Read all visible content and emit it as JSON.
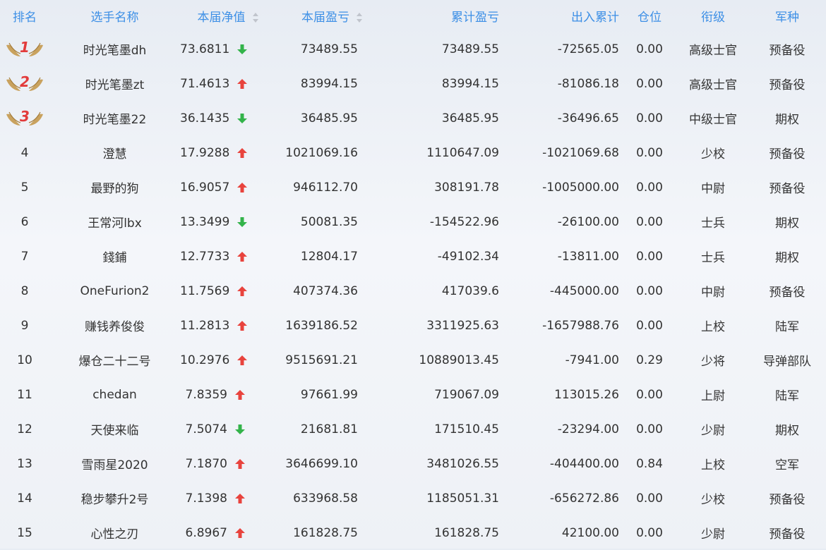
{
  "headers": {
    "rank": "排名",
    "name": "选手名称",
    "nav": "本届净值",
    "profit": "本届盈亏",
    "cum_profit": "累计盈亏",
    "flow": "出入累计",
    "position": "仓位",
    "title": "衔级",
    "branch": "军种"
  },
  "colors": {
    "header": "#3d8fe6",
    "up": "#e8433d",
    "down": "#33b34a",
    "medal_wing": "#c9a25e",
    "medal_num": "#e23b3b"
  },
  "rows": [
    {
      "rank": "1",
      "name": "时光笔墨dh",
      "nav": "73.6811",
      "trend": "down",
      "profit": "73489.55",
      "cum_profit": "73489.55",
      "flow": "-72565.05",
      "position": "0.00",
      "title": "高级士官",
      "branch": "预备役"
    },
    {
      "rank": "2",
      "name": "时光笔墨zt",
      "nav": "71.4613",
      "trend": "up",
      "profit": "83994.15",
      "cum_profit": "83994.15",
      "flow": "-81086.18",
      "position": "0.00",
      "title": "高级士官",
      "branch": "预备役"
    },
    {
      "rank": "3",
      "name": "时光笔墨22",
      "nav": "36.1435",
      "trend": "down",
      "profit": "36485.95",
      "cum_profit": "36485.95",
      "flow": "-36496.65",
      "position": "0.00",
      "title": "中级士官",
      "branch": "期权"
    },
    {
      "rank": "4",
      "name": "澄慧",
      "nav": "17.9288",
      "trend": "up",
      "profit": "1021069.16",
      "cum_profit": "1110647.09",
      "flow": "-1021069.68",
      "position": "0.00",
      "title": "少校",
      "branch": "预备役"
    },
    {
      "rank": "5",
      "name": "最野的狗",
      "nav": "16.9057",
      "trend": "up",
      "profit": "946112.70",
      "cum_profit": "308191.78",
      "flow": "-1005000.00",
      "position": "0.00",
      "title": "中尉",
      "branch": "预备役"
    },
    {
      "rank": "6",
      "name": "王常河lbx",
      "nav": "13.3499",
      "trend": "down",
      "profit": "50081.35",
      "cum_profit": "-154522.96",
      "flow": "-26100.00",
      "position": "0.00",
      "title": "士兵",
      "branch": "期权"
    },
    {
      "rank": "7",
      "name": "錢鋪",
      "nav": "12.7733",
      "trend": "up",
      "profit": "12804.17",
      "cum_profit": "-49102.34",
      "flow": "-13811.00",
      "position": "0.00",
      "title": "士兵",
      "branch": "期权"
    },
    {
      "rank": "8",
      "name": "OneFurion2",
      "nav": "11.7569",
      "trend": "up",
      "profit": "407374.36",
      "cum_profit": "417039.6",
      "flow": "-445000.00",
      "position": "0.00",
      "title": "中尉",
      "branch": "预备役"
    },
    {
      "rank": "9",
      "name": "赚钱养俊俊",
      "nav": "11.2813",
      "trend": "up",
      "profit": "1639186.52",
      "cum_profit": "3311925.63",
      "flow": "-1657988.76",
      "position": "0.00",
      "title": "上校",
      "branch": "陆军"
    },
    {
      "rank": "10",
      "name": "爆仓二十二号",
      "nav": "10.2976",
      "trend": "up",
      "profit": "9515691.21",
      "cum_profit": "10889013.45",
      "flow": "-7941.00",
      "position": "0.29",
      "title": "少将",
      "branch": "导弹部队"
    },
    {
      "rank": "11",
      "name": "chedan",
      "nav": "7.8359",
      "trend": "up",
      "profit": "97661.99",
      "cum_profit": "719067.09",
      "flow": "113015.26",
      "position": "0.00",
      "title": "上尉",
      "branch": "陆军"
    },
    {
      "rank": "12",
      "name": "天使来临",
      "nav": "7.5074",
      "trend": "down",
      "profit": "21681.81",
      "cum_profit": "171510.45",
      "flow": "-23294.00",
      "position": "0.00",
      "title": "少尉",
      "branch": "期权"
    },
    {
      "rank": "13",
      "name": "雪雨星2020",
      "nav": "7.1870",
      "trend": "up",
      "profit": "3646699.10",
      "cum_profit": "3481026.55",
      "flow": "-404400.00",
      "position": "0.84",
      "title": "上校",
      "branch": "空军"
    },
    {
      "rank": "14",
      "name": "稳步攀升2号",
      "nav": "7.1398",
      "trend": "up",
      "profit": "633968.58",
      "cum_profit": "1185051.31",
      "flow": "-656272.86",
      "position": "0.00",
      "title": "少校",
      "branch": "预备役"
    },
    {
      "rank": "15",
      "name": "心性之刃",
      "nav": "6.8967",
      "trend": "up",
      "profit": "161828.75",
      "cum_profit": "161828.75",
      "flow": "42100.00",
      "position": "0.00",
      "title": "少尉",
      "branch": "预备役"
    }
  ]
}
